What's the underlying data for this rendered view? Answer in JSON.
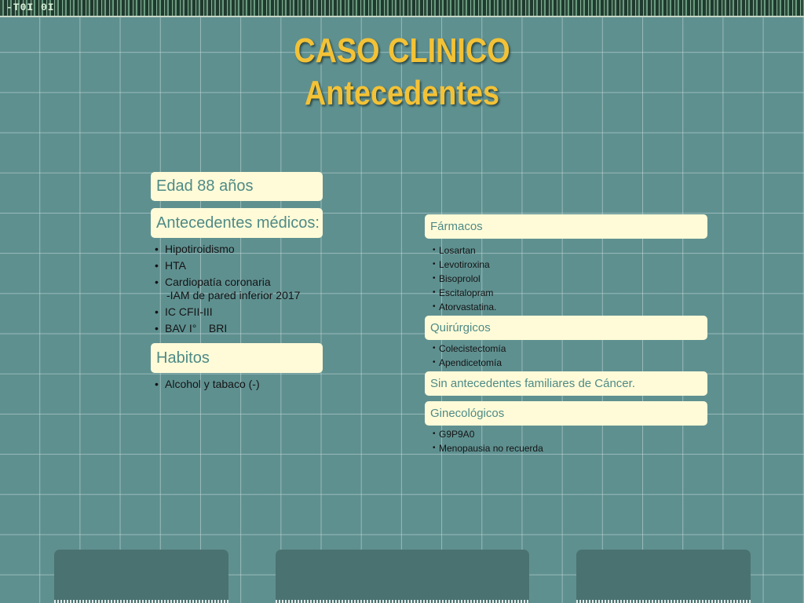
{
  "topbar": {
    "text": "-T0I 0I"
  },
  "title": {
    "line1": "CASO CLINICO",
    "line2": "Antecedentes"
  },
  "left": {
    "edad": "Edad 88 años",
    "medicos": {
      "label": "Antecedentes médicos:",
      "items": [
        "Hipotiroidismo",
        "HTA",
        "Cardiopatía coronaria",
        "IC CFII-III",
        "BAV I°    BRI"
      ],
      "subitem": "-IAM  de pared inferior 2017"
    },
    "habitos": {
      "label": "Habitos",
      "items": [
        "Alcohol y tabaco (-)"
      ]
    }
  },
  "right": {
    "farmacos": {
      "label": "Fármacos",
      "items": [
        "Losartan",
        "Levotiroxina",
        "Bisoprolol",
        "Escitalopram",
        "Atorvastatina."
      ]
    },
    "quirurgicos": {
      "label": "Quirúrgicos",
      "items": [
        "Colecistectomía",
        "Apendicetomía"
      ]
    },
    "familiares": {
      "label": "Sin antecedentes familiares de Cáncer."
    },
    "ginecologicos": {
      "label": "Ginecológicos",
      "items": [
        "G9P9A0",
        "Menopausia no recuerda"
      ]
    }
  },
  "colors": {
    "background": "#5f9090",
    "title": "#f3c236",
    "box_fill": "#fffbd8",
    "box_text": "#4e8a86"
  }
}
